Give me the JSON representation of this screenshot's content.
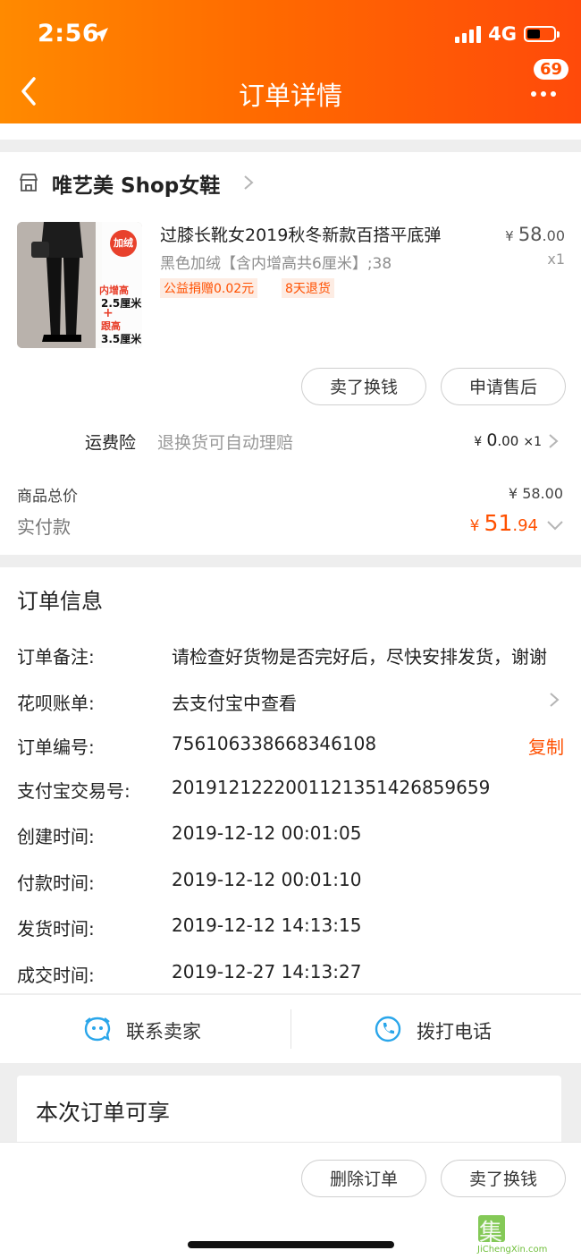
{
  "status_bar": {
    "time": "2:56",
    "network": "4G"
  },
  "nav": {
    "title": "订单详情",
    "badge": "69"
  },
  "shop": {
    "name": "唯艺美 Shop女鞋"
  },
  "product": {
    "thumb_tag": "加绒",
    "thumb_line1": "内增高",
    "thumb_line2": "2.5厘米",
    "thumb_plus": "+",
    "thumb_line3": "跟高",
    "thumb_line4": "3.5厘米",
    "title": "过膝长靴女2019秋冬新款百搭平底弹",
    "sku": "黑色加绒【含内增高共6厘米】;38",
    "tag_charity": "公益捐赠0.02元",
    "tag_return": "8天退货",
    "price_symbol": "¥",
    "price_int": "58",
    "price_dec": ".00",
    "qty": "x1"
  },
  "actions": {
    "sell_exchange": "卖了换钱",
    "after_sale": "申请售后"
  },
  "insurance": {
    "label": "运费险",
    "desc": "退换货可自动理赔",
    "price_symbol": "¥",
    "price_int": "0",
    "price_dec": ".00",
    "qty": "×1"
  },
  "totals": {
    "goods_label": "商品总价",
    "goods_value": "¥ 58.00",
    "paid_label": "实付款",
    "paid_symbol": "¥",
    "paid_int": "51",
    "paid_dec": ".94"
  },
  "order_info": {
    "title": "订单信息",
    "rows": [
      {
        "label": "订单备注:",
        "value": "请检查好货物是否完好后，尽快安排发货，谢谢"
      },
      {
        "label": "花呗账单:",
        "value": "去支付宝中查看"
      },
      {
        "label": "订单编号:",
        "value": "756106338668346108"
      },
      {
        "label": "支付宝交易号:",
        "value": "2019121222001121351426859659"
      },
      {
        "label": "创建时间:",
        "value": "2019-12-12 00:01:05"
      },
      {
        "label": "付款时间:",
        "value": "2019-12-12 00:01:10"
      },
      {
        "label": "发货时间:",
        "value": "2019-12-12 14:13:15"
      },
      {
        "label": "成交时间:",
        "value": "2019-12-27 14:13:27"
      }
    ],
    "copy_label": "复制"
  },
  "contact": {
    "seller": "联系卖家",
    "phone": "拨打电话"
  },
  "benefits": {
    "title": "本次订单可享"
  },
  "footer": {
    "delete": "删除订单",
    "sell_exchange": "卖了换钱"
  },
  "watermark": {
    "text": "集诚信",
    "url": "JiChengXin.com"
  },
  "colors": {
    "accent": "#ff5000",
    "header_start": "#ff8a00",
    "header_end": "#ff4a0a",
    "blue_icon": "#2aa6ea"
  }
}
